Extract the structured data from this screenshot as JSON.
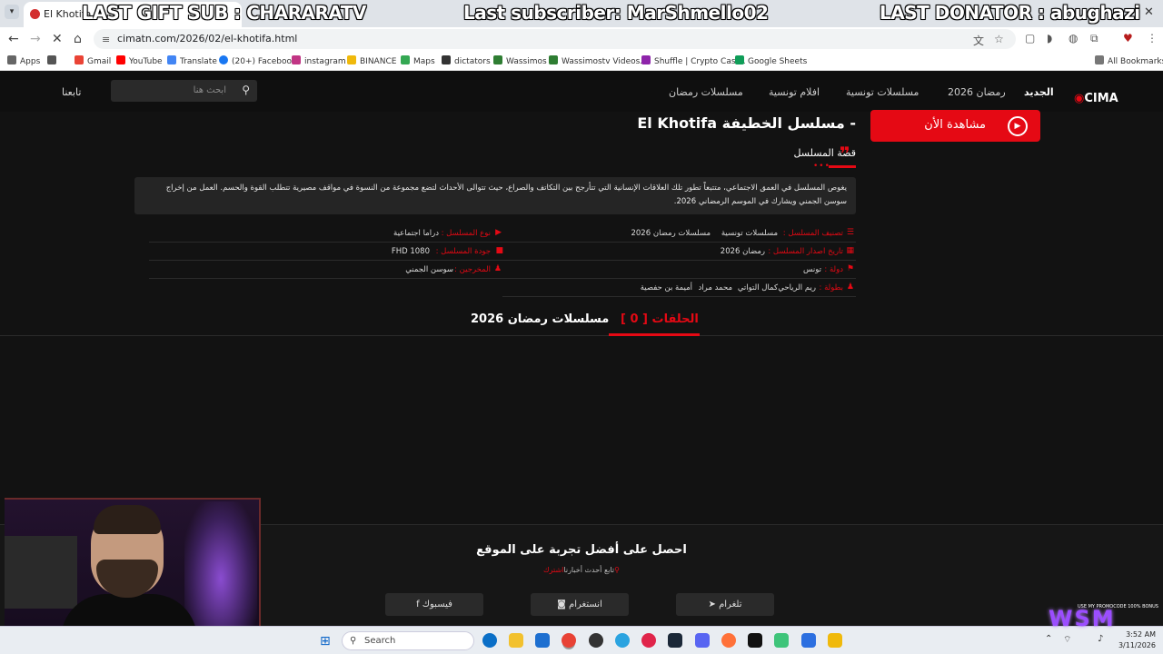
{
  "browser": {
    "tab_title": "El Khotifa",
    "url": "cimatn.com/2026/02/el-khotifa.html",
    "bookmarks": [
      "Apps",
      "Gmail",
      "YouTube",
      "Translate",
      "(20+) Facebook",
      "instagram",
      "BINANCE",
      "Maps",
      "dictators",
      "Wassimos",
      "Wassimostv Videos...",
      "Shuffle | Crypto Casi...",
      "Google Sheets"
    ],
    "all_bookmarks": "All Bookmarks"
  },
  "overlay": {
    "last_gift": "LAST GIFT SUB : CHARARATV",
    "last_sub": "Last subscriber: MarShmello02",
    "last_donator": "LAST DONATOR : abughazi"
  },
  "site": {
    "logo": "CIMA",
    "nav": [
      "الجديد",
      "رمضان 2026",
      "مسلسلات تونسية",
      "افلام تونسية",
      "مسلسلات رمضان"
    ],
    "search_placeholder": "ابحث هنا",
    "follow": "تابعنا"
  },
  "series": {
    "watch_now": "مشاهدة الأن",
    "title": "El Khotifa مسلسل الخطيفة -",
    "story_heading": "قصة المسلسل",
    "story": "يغوص المسلسل في العمق الاجتماعي، متتبعاً تطور تلك العلاقات الإنسانية التي تتأرجح بين التكاتف والصراع، حيث تتوالى الأحداث لتضع مجموعة من النسوة في مواقف مصيرية تتطلب القوة والحسم. العمل من إخراج سوسن الجمني ويشارك في الموسم الرمضاني 2026.",
    "info": {
      "category_label": "تصنيف المسلسل :",
      "category_values": [
        "مسلسلات تونسية",
        "مسلسلات رمضان 2026"
      ],
      "type_label": "نوع المسلسل :",
      "type_value": "دراما اجتماعية",
      "release_label": "تاريخ اصدار المسلسل :",
      "release_value": "رمضان 2026",
      "quality_label": "جودة المسلسل :",
      "quality_value": "FHD 1080",
      "country_label": "دولة :",
      "country_value": "تونس",
      "directors_label": "المخرجين :",
      "directors_value": "سوسن الجمني",
      "cast_label": "بطولة :",
      "cast_values": [
        "ريم الرياحي",
        "كمال التواتي",
        "محمد مراد",
        "أميمة بن حفصية"
      ]
    },
    "tabs": {
      "episodes": "الحلقات [ 0 ]",
      "ramadan": "مسلسلات رمضان 2026"
    }
  },
  "footer": {
    "title": "احصل على أفضل تجربة على الموقع",
    "subscribe": "اشترك",
    "subscribe_rest": "تابع أحدث أخبارنا",
    "facebook": "فيسبوك",
    "instagram": "انستغرام",
    "telegram": "تلغرام"
  },
  "taskbar": {
    "search": "Search",
    "time": "3:52 AM",
    "date": "3/11/2026"
  },
  "stream": {
    "wsm": "WSM",
    "promo": "USE MY PROMOCODE 100% BONUS"
  }
}
